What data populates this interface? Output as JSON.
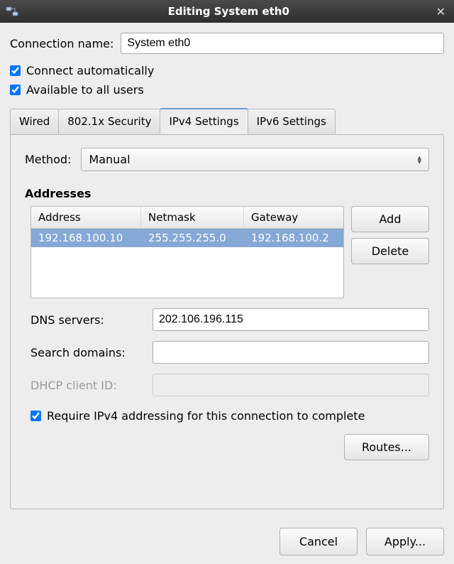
{
  "window": {
    "title": "Editing System eth0"
  },
  "connection_name_label": "Connection name:",
  "connection_name_value": "System eth0",
  "connect_automatically_label": "Connect automatically",
  "connect_automatically_checked": true,
  "available_all_users_label": "Available to all users",
  "available_all_users_checked": true,
  "tabs": {
    "wired": "Wired",
    "security": "802.1x Security",
    "ipv4": "IPv4 Settings",
    "ipv6": "IPv6 Settings",
    "active": "ipv4"
  },
  "ipv4": {
    "method_label": "Method:",
    "method_value": "Manual",
    "addresses_title": "Addresses",
    "columns": {
      "address": "Address",
      "netmask": "Netmask",
      "gateway": "Gateway"
    },
    "rows": [
      {
        "address": "192.168.100.10",
        "netmask": "255.255.255.0",
        "gateway": "192.168.100.2"
      }
    ],
    "add_button": "Add",
    "delete_button": "Delete",
    "dns_label": "DNS servers:",
    "dns_value": "202.106.196.115",
    "search_domains_label": "Search domains:",
    "search_domains_value": "",
    "dhcp_client_id_label": "DHCP client ID:",
    "dhcp_client_id_value": "",
    "require_ipv4_label": "Require IPv4 addressing for this connection to complete",
    "require_ipv4_checked": true,
    "routes_button": "Routes..."
  },
  "buttons": {
    "cancel": "Cancel",
    "apply": "Apply..."
  }
}
